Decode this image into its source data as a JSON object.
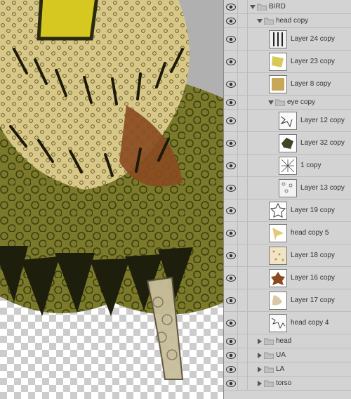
{
  "layers": {
    "root": {
      "name": "BIRD"
    },
    "head_copy": {
      "name": "head copy"
    },
    "l24": {
      "name": "Layer 24 copy"
    },
    "l23": {
      "name": "Layer 23 copy"
    },
    "l8": {
      "name": "Layer 8 copy"
    },
    "eye_copy": {
      "name": "eye copy"
    },
    "l12": {
      "name": "Layer 12 copy"
    },
    "l32": {
      "name": "Layer 32 copy"
    },
    "l1": {
      "name": "1 copy"
    },
    "l13": {
      "name": "Layer 13 copy"
    },
    "l19": {
      "name": "Layer 19 copy"
    },
    "hc5": {
      "name": "head copy 5"
    },
    "l18": {
      "name": "Layer 18 copy"
    },
    "l16": {
      "name": "Layer 16 copy"
    },
    "l17": {
      "name": "Layer 17 copy"
    },
    "hc4": {
      "name": "head copy 4"
    },
    "head": {
      "name": "head"
    },
    "ua": {
      "name": "UA"
    },
    "la": {
      "name": "LA"
    },
    "torso": {
      "name": "torso"
    }
  },
  "colors": {
    "panel": "#d3d3d3",
    "olive": "#7a7a2a",
    "rust": "#7a4a20",
    "cream": "#d8c888"
  }
}
